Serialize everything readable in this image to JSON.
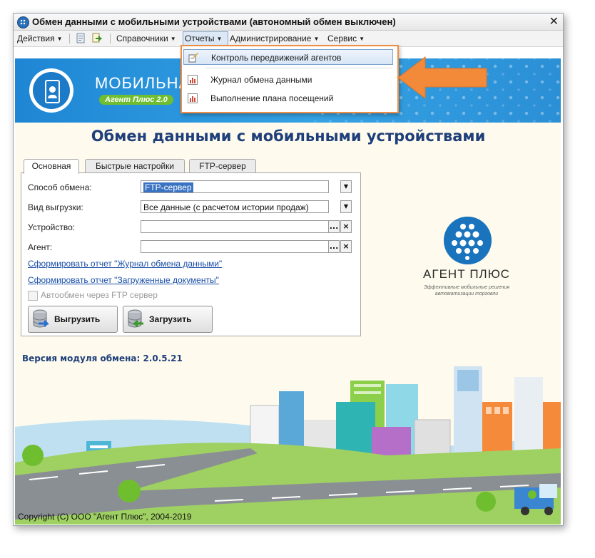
{
  "window": {
    "title": "Обмен данными с мобильными устройствами (автономный обмен выключен)",
    "close": "✕"
  },
  "menu": {
    "actions": "Действия",
    "references": "Справочники",
    "reports": "Отчеты",
    "administration": "Администрирование",
    "service": "Сервис"
  },
  "dropdown": {
    "items": [
      {
        "label": "Контроль передвижений агентов"
      },
      {
        "label": "Журнал обмена данными"
      },
      {
        "label": "Выполнение плана посещений"
      }
    ]
  },
  "banner": {
    "brand_name": "МОБИЛЬНАЯ",
    "brand_badge": "Агент Плюс 2.0"
  },
  "heading": "Обмен данными с мобильными устройствами",
  "tabs": [
    {
      "label": "Основная"
    },
    {
      "label": "Быстрые настройки"
    },
    {
      "label": "FTP-сервер"
    }
  ],
  "form": {
    "exchange_method_label": "Способ обмена:",
    "exchange_method_value": "FTP-сервер",
    "upload_type_label": "Вид выгрузки:",
    "upload_type_value": "Все данные (с расчетом истории продаж)",
    "device_label": "Устройство:",
    "device_value": "",
    "agent_label": "Агент:",
    "agent_value": "",
    "link_journal": "Сформировать отчет \"Журнал обмена данными\"",
    "link_docs": "Сформировать отчет \"Загруженные документы\"",
    "auto_exchange_label": "Автообмен через FTP сервер",
    "auto_exchange_checked": false,
    "btn_upload": "Выгрузить",
    "btn_download": "Загрузить",
    "select_btn": "...",
    "clear_btn": "×",
    "dropdown_btn": "▼"
  },
  "version": "Версия модуля обмена: 2.0.5.21",
  "logo": {
    "name": "АГЕНТ ПЛЮС",
    "tagline": "Эффективные мобильные решения автоматизации торговли"
  },
  "copyright": "Copyright (C) ООО \"Агент Плюс\", 2004-2019",
  "colors": {
    "highlight_border": "#ee8d43",
    "heading": "#1f3f7a",
    "link": "#1a4fa8",
    "banner": "#1e86d4"
  }
}
